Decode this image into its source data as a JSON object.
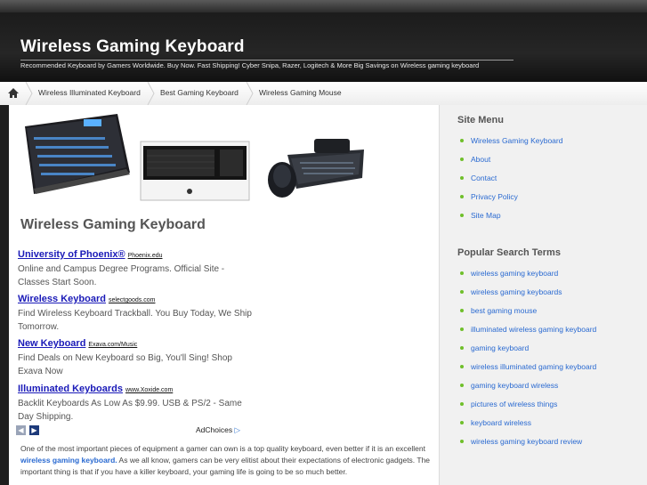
{
  "header": {
    "title": "Wireless Gaming Keyboard",
    "tagline": "Recommended Keyboard by Gamers Worldwide. Buy Now. Fast Shipping! Cyber Snipa, Razer, Logitech & More Big Savings on Wireless gaming keyboard"
  },
  "nav": {
    "items": [
      "Wireless Illuminated Keyboard",
      "Best Gaming Keyboard",
      "Wireless Gaming Mouse"
    ]
  },
  "main": {
    "page_title": "Wireless Gaming Keyboard",
    "ads": [
      {
        "title": "University of Phoenix®",
        "url": "Phoenix.edu",
        "desc": "Online and Campus Degree Programs. Official Site - Classes Start Soon."
      },
      {
        "title": "Wireless Keyboard",
        "url": "selectgoods.com",
        "desc": "Find Wireless Keyboard Trackball. You Buy Today, We Ship Tomorrow."
      },
      {
        "title": "New Keyboard",
        "url": "Exava.com/Music",
        "desc": "Find Deals on New Keyboard so Big, You'll Sing! Shop Exava Now"
      },
      {
        "title": "Illuminated Keyboards",
        "url": "www.Xoxide.com",
        "desc": "Backlit Keyboards As Low As $9.99. USB & PS/2 - Same Day Shipping."
      }
    ],
    "adchoices": "AdChoices",
    "body_pre": "One of the most important pieces of equipment a gamer can own is a top quality keyboard, even better if it is an excellent ",
    "body_link": "wireless gaming keyboard.",
    "body_post": " As we all know, gamers can be very elitist about their expectations of electronic gadgets.  The important thing is that if you have a killer keyboard, your gaming life is going to be so much better."
  },
  "sidebar": {
    "menu_heading": "Site Menu",
    "menu_items": [
      "Wireless Gaming Keyboard",
      "About",
      "Contact",
      "Privacy Policy",
      "Site Map"
    ],
    "terms_heading": "Popular Search Terms",
    "terms": [
      "wireless gaming keyboard",
      "wireless gaming keyboards",
      "best gaming mouse",
      "illuminated wireless gaming keyboard",
      "gaming keyboard",
      "wireless illuminated gaming keyboard",
      "gaming keyboard wireless",
      "pictures of wireless things",
      "keyboard wireless",
      "wireless gaming keyboard review"
    ]
  },
  "colors": {
    "link": "#2a6ad1",
    "ad_title": "#1a1ab8",
    "bullet": "#6fbf2a",
    "header_bg": "#1b1b1b"
  }
}
